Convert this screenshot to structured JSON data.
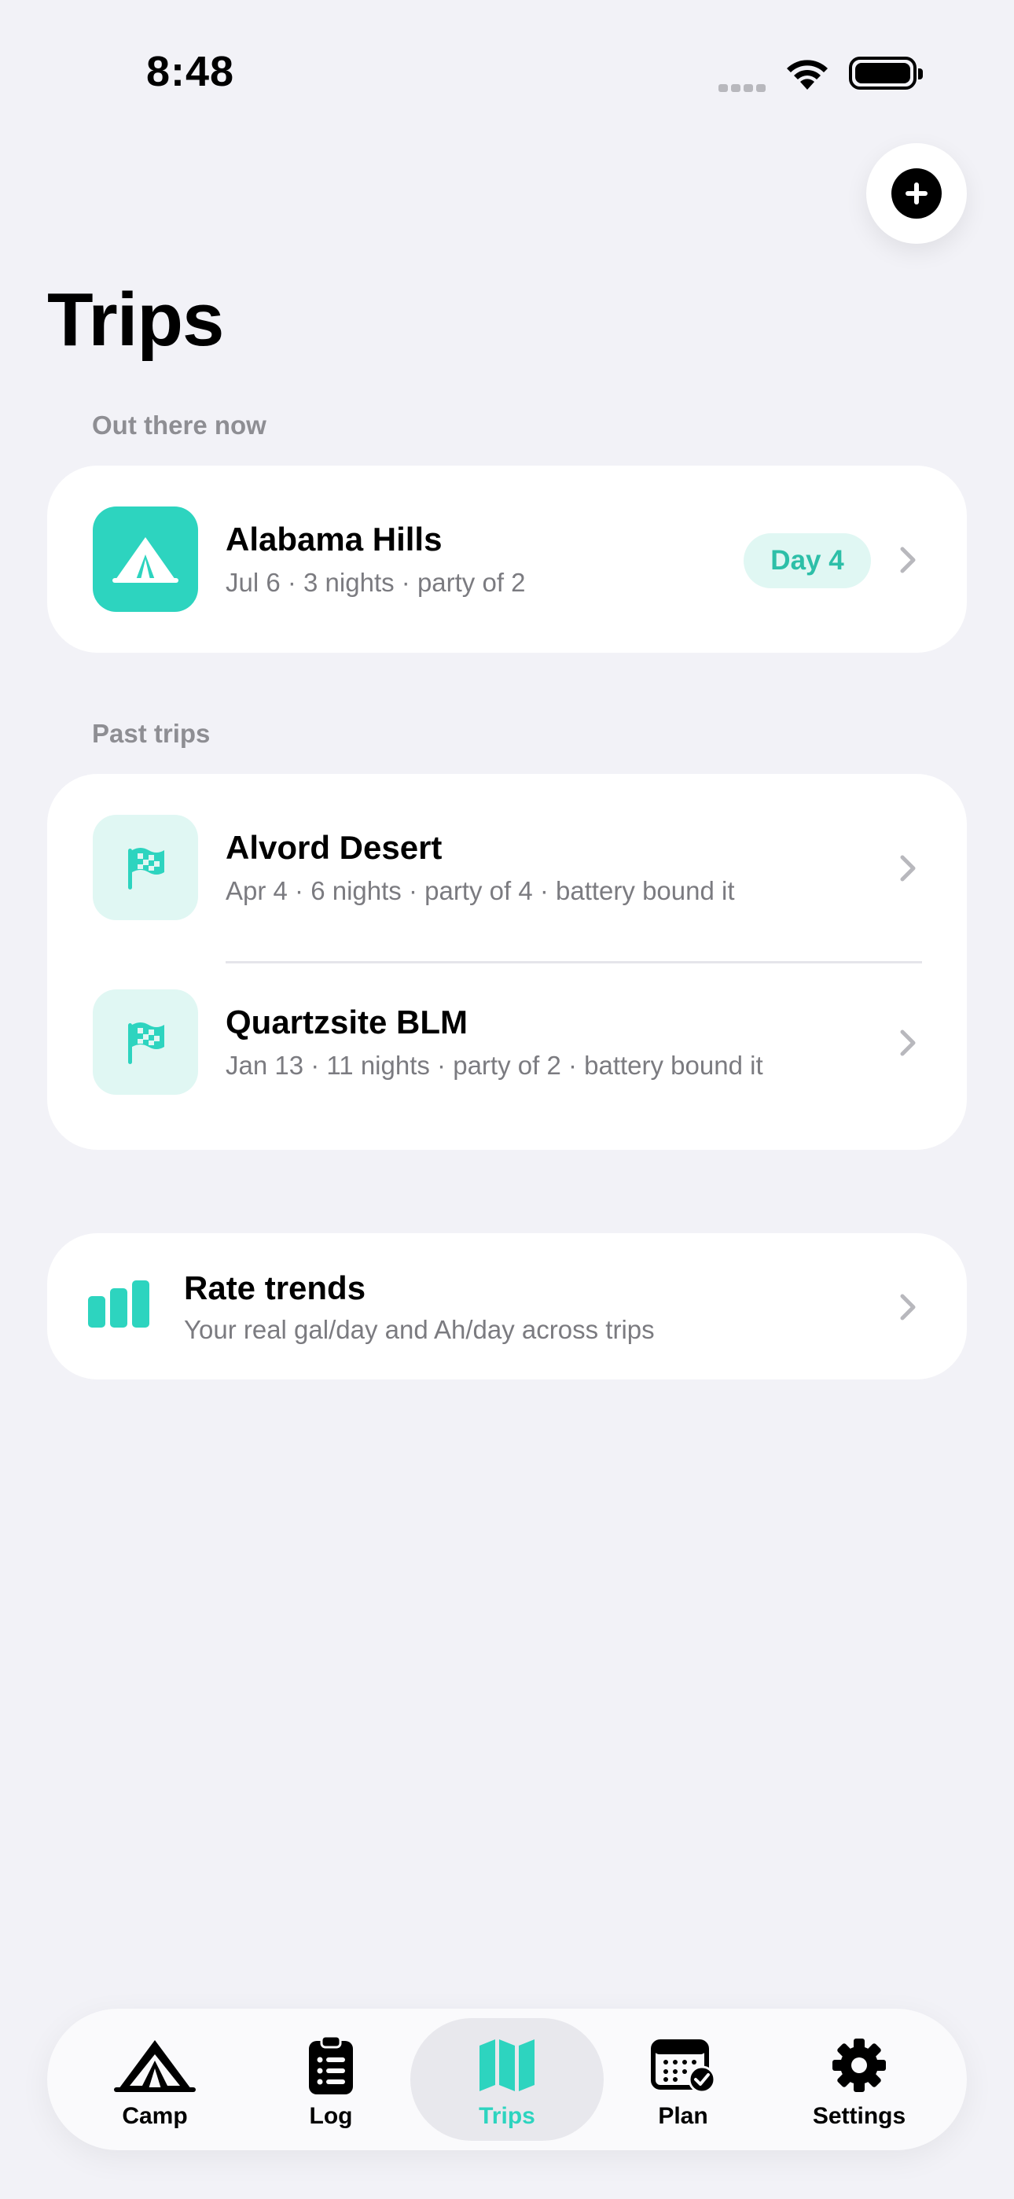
{
  "status_bar": {
    "time": "8:48"
  },
  "header": {
    "title": "Trips"
  },
  "sections": {
    "current_label": "Out there now",
    "past_label": "Past trips"
  },
  "current_trip": {
    "name": "Alabama Hills",
    "details": "Jul 6 · 3 nights · party of 2",
    "badge": "Day 4",
    "icon": "tent-icon"
  },
  "past_trips": [
    {
      "name": "Alvord Desert",
      "details": "Apr 4 · 6 nights · party of 4 · battery bound it",
      "icon": "checkered-flag-icon"
    },
    {
      "name": "Quartzsite BLM",
      "details": "Jan 13 · 11 nights · party of 2 · battery bound it",
      "icon": "checkered-flag-icon"
    }
  ],
  "rate_trends": {
    "title": "Rate trends",
    "subtitle": "Your real gal/day and Ah/day across trips",
    "icon": "bar-chart-icon"
  },
  "tabbar": {
    "active": "Trips",
    "tabs": [
      {
        "label": "Camp",
        "icon": "tent-icon"
      },
      {
        "label": "Log",
        "icon": "clipboard-list-icon"
      },
      {
        "label": "Trips",
        "icon": "map-icon"
      },
      {
        "label": "Plan",
        "icon": "calendar-check-icon"
      },
      {
        "label": "Settings",
        "icon": "gear-icon"
      }
    ]
  },
  "colors": {
    "accent": "#2dd4bf",
    "accent_soft": "#e0f7f3",
    "background": "#f2f2f7",
    "card": "#ffffff",
    "secondary_text": "#7b7b80"
  }
}
